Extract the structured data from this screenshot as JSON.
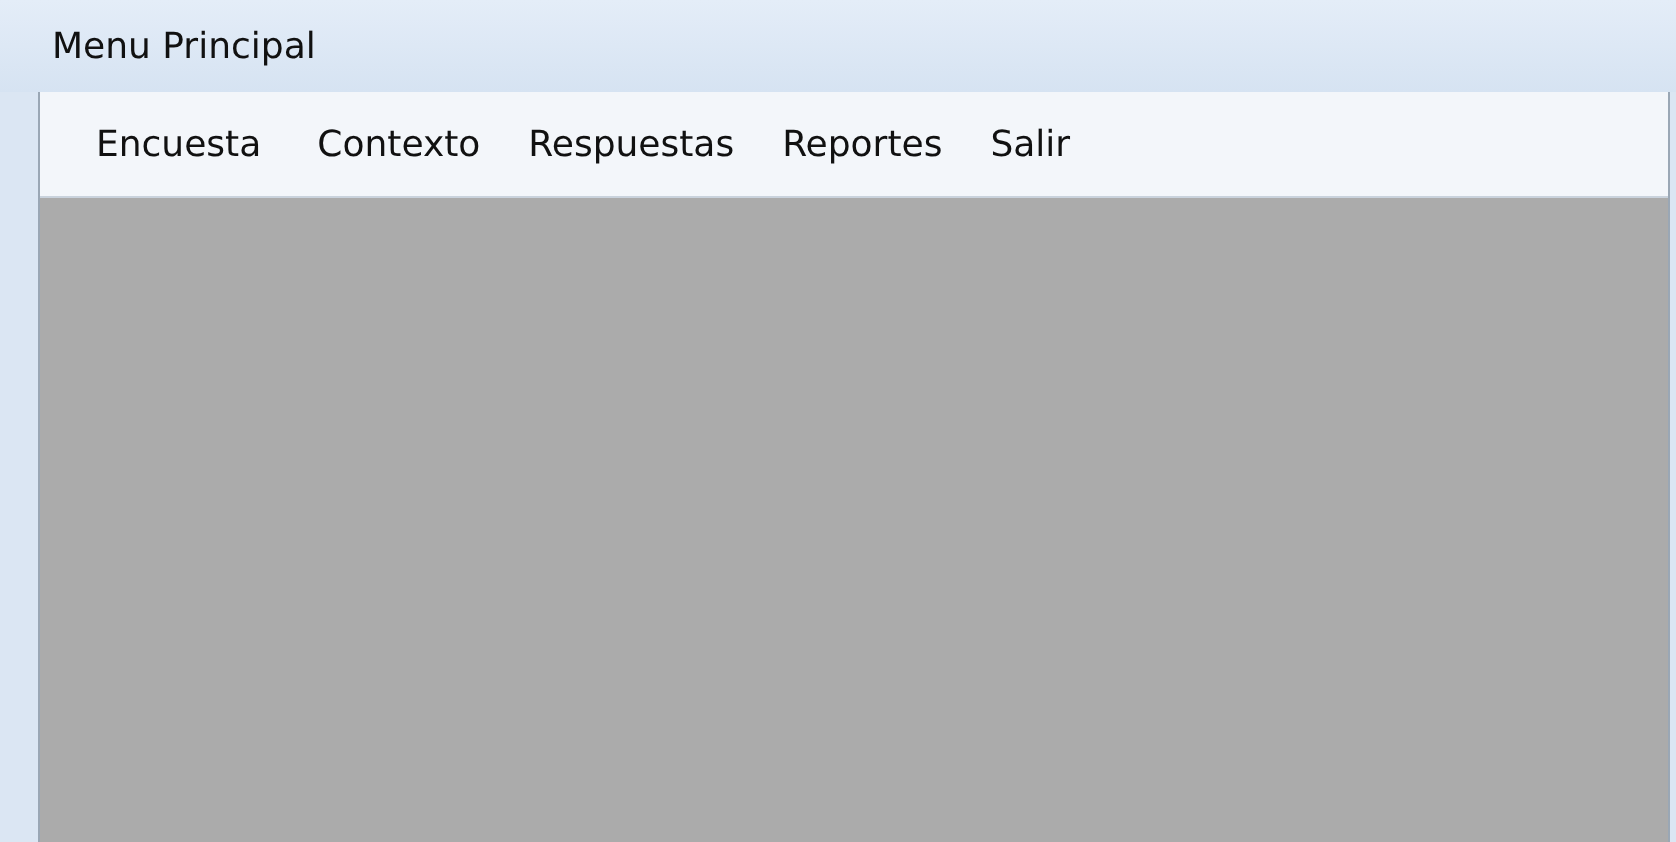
{
  "window": {
    "title": "Menu Principal"
  },
  "menu": [
    {
      "label": "Encuesta"
    },
    {
      "label": "Contexto"
    },
    {
      "label": "Respuestas"
    },
    {
      "label": "Reportes"
    },
    {
      "label": "Salir"
    }
  ]
}
